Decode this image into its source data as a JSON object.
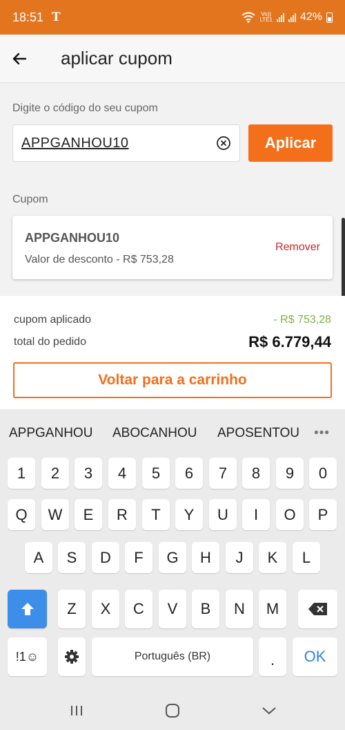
{
  "status_bar": {
    "time": "18:51",
    "carrier": "T",
    "volte_top": "Vo))",
    "volte_bottom": "LTE1",
    "battery": "42%"
  },
  "header": {
    "title": "aplicar cupom"
  },
  "coupon_form": {
    "label": "Digite o código do seu cupom",
    "input_value": "APPGANHOU10",
    "apply_label": "Aplicar"
  },
  "applied": {
    "section_label": "Cupom",
    "code": "APPGANHOU10",
    "description": "Valor de desconto - R$ 753,28",
    "remove_label": "Remover"
  },
  "summary": {
    "applied_label": "cupom aplicado",
    "applied_value": "- R$ 753,28",
    "total_label": "total do pedido",
    "total_value": "R$ 6.779,44",
    "back_label": "Voltar para a carrinho"
  },
  "keyboard": {
    "suggestions": [
      "APPGANHOU",
      "ABOCANHOU",
      "APOSENTOU"
    ],
    "more": "•••",
    "row_numbers": [
      "1",
      "2",
      "3",
      "4",
      "5",
      "6",
      "7",
      "8",
      "9",
      "0"
    ],
    "row1": [
      "Q",
      "W",
      "E",
      "R",
      "T",
      "Y",
      "U",
      "I",
      "O",
      "P"
    ],
    "row2": [
      "A",
      "S",
      "D",
      "F",
      "G",
      "H",
      "J",
      "K",
      "L"
    ],
    "row3": [
      "Z",
      "X",
      "C",
      "V",
      "B",
      "N",
      "M"
    ],
    "symbols_label": "!1☺",
    "space_label": "Português (BR)",
    "period_label": ".",
    "ok_label": "OK"
  },
  "colors": {
    "brand_orange": "#e2751e",
    "button_orange": "#f36f1a",
    "remove_red": "#c62828",
    "discount_green": "#7cb342",
    "shift_blue": "#3d8ee8"
  }
}
